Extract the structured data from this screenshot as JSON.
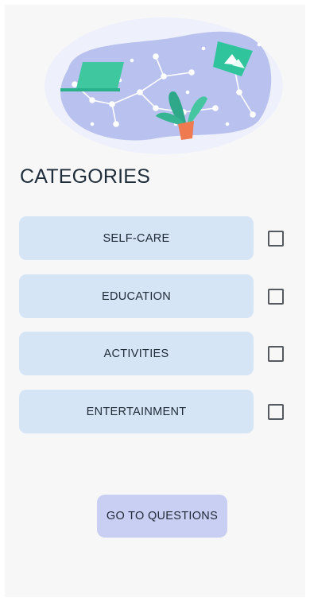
{
  "header": {
    "title": "CATEGORIES"
  },
  "illustration": {
    "name": "constellation-illustration"
  },
  "categories": [
    {
      "label": "SELF-CARE",
      "checked": false
    },
    {
      "label": "EDUCATION",
      "checked": false
    },
    {
      "label": "ACTIVITIES",
      "checked": false
    },
    {
      "label": "ENTERTAINMENT",
      "checked": false
    }
  ],
  "actions": {
    "go_label": "GO TO QUESTIONS"
  },
  "colors": {
    "background": "#f7f7f8",
    "category_button": "#d6e5f6",
    "primary_button": "#c9cef3",
    "blob": "#b9c2ee",
    "text": "#1e2a36"
  }
}
